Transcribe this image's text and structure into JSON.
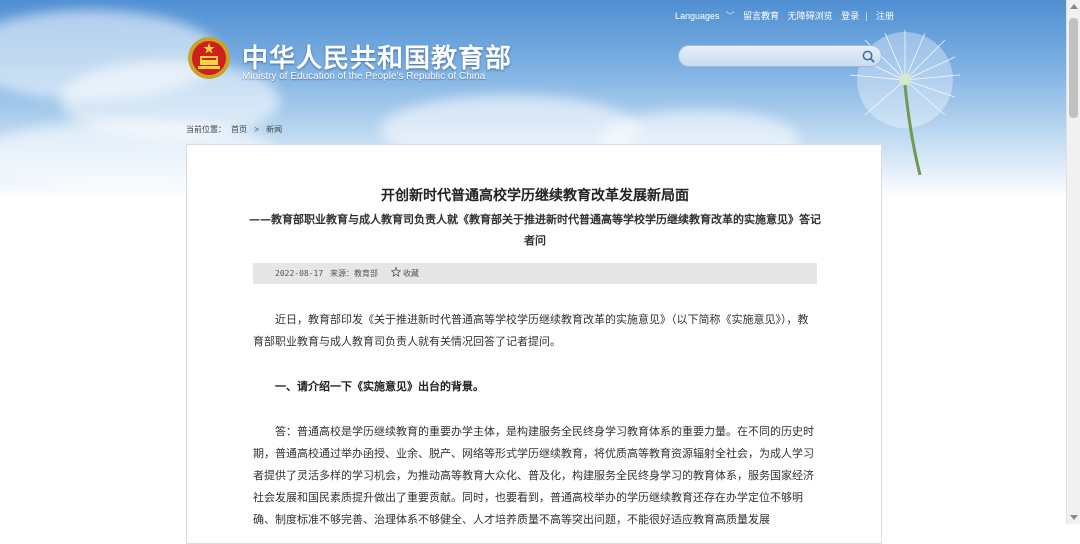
{
  "header": {
    "site_title_cn": "中华人民共和国教育部",
    "site_title_en": "Ministry of Education of the People's Republic of China",
    "emblem_icon": "national-emblem-icon",
    "top_links": [
      "Languages",
      "留言教育",
      "无障碍浏览",
      "登录",
      "注册"
    ],
    "search_placeholder": "",
    "search_icon": "search-icon"
  },
  "breadcrumb": {
    "label": "当前位置：",
    "home": "首页",
    "separator": ">",
    "current": "新闻"
  },
  "article": {
    "title": "开创新时代普通高校学历继续教育改革发展新局面",
    "subtitle": "——教育部职业教育与成人教育司负责人就《教育部关于推进新时代普通高等学校学历继续教育改革的实施意见》答记者问",
    "meta": {
      "date": "2022-08-17",
      "source": "来源：教育部",
      "favorite": "收藏"
    },
    "paragraph1": "近日，教育部印发《关于推进新时代普通高等学校学历继续教育改革的实施意见》（以下简称《实施意见》），教育部职业教育与成人教育司负责人就有关情况回答了记者提问。",
    "heading1": "一、请介绍一下《实施意见》出台的背景。",
    "paragraph2": "答：普通高校是学历继续教育的重要办学主体，是构建服务全民终身学习教育体系的重要力量。在不同的历史时期，普通高校通过举办函授、业余、脱产、网络等形式学历继续教育，将优质高等教育资源辐射全社会，为成人学习者提供了灵活多样的学习机会，为推动高等教育大众化、普及化，构建服务全民终身学习的教育体系，服务国家经济社会发展和国民素质提升做出了重要贡献。同时，也要看到，普通高校举办的学历继续教育还存在办学定位不够明确、制度标准不够完善、治理体系不够健全、人才培养质量不高等突出问题，不能很好适应教育高质量发展"
  },
  "colors": {
    "sky_top": "#4f8fd2",
    "panel_border": "#dcdcdc",
    "meta_bar": "#e6e6e6"
  }
}
